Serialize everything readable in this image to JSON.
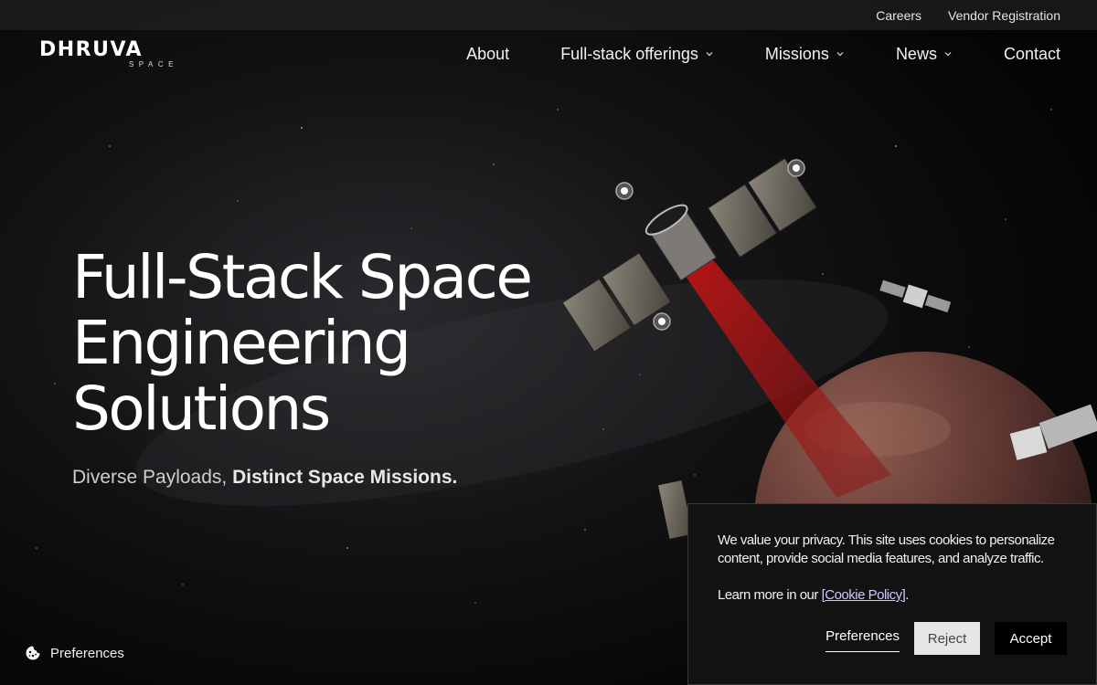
{
  "topbar": {
    "links": [
      "Careers",
      "Vendor Registration"
    ]
  },
  "logo": {
    "main": "DHRUVA",
    "sub": "SPACE"
  },
  "nav": {
    "items": [
      {
        "label": "About",
        "has_dropdown": false
      },
      {
        "label": "Full-stack offerings",
        "has_dropdown": true
      },
      {
        "label": "Missions",
        "has_dropdown": true
      },
      {
        "label": "News",
        "has_dropdown": true
      },
      {
        "label": "Contact",
        "has_dropdown": false
      }
    ]
  },
  "hero": {
    "title_line1": "Full-Stack Space",
    "title_line2": "Engineering",
    "title_line3": "Solutions",
    "subtitle_regular": "Diverse Payloads,",
    "subtitle_bold": "Distinct Space Missions."
  },
  "preferences_float": {
    "label": "Preferences",
    "icon": "cookie-icon"
  },
  "cookie_banner": {
    "message": "We value your privacy. This site uses cookies to personalize content, provide social media features, and analyze traffic.",
    "learn_prefix": "Learn more in our",
    "policy_link": "[Cookie Policy]",
    "learn_suffix": ".",
    "preferences_label": "Preferences",
    "reject_label": "Reject",
    "accept_label": "Accept"
  },
  "colors": {
    "background": "#050505",
    "beam": "#b01818",
    "planet": "#6e4038",
    "reject_bg": "#e6e6e6",
    "accept_bg": "#000000"
  }
}
